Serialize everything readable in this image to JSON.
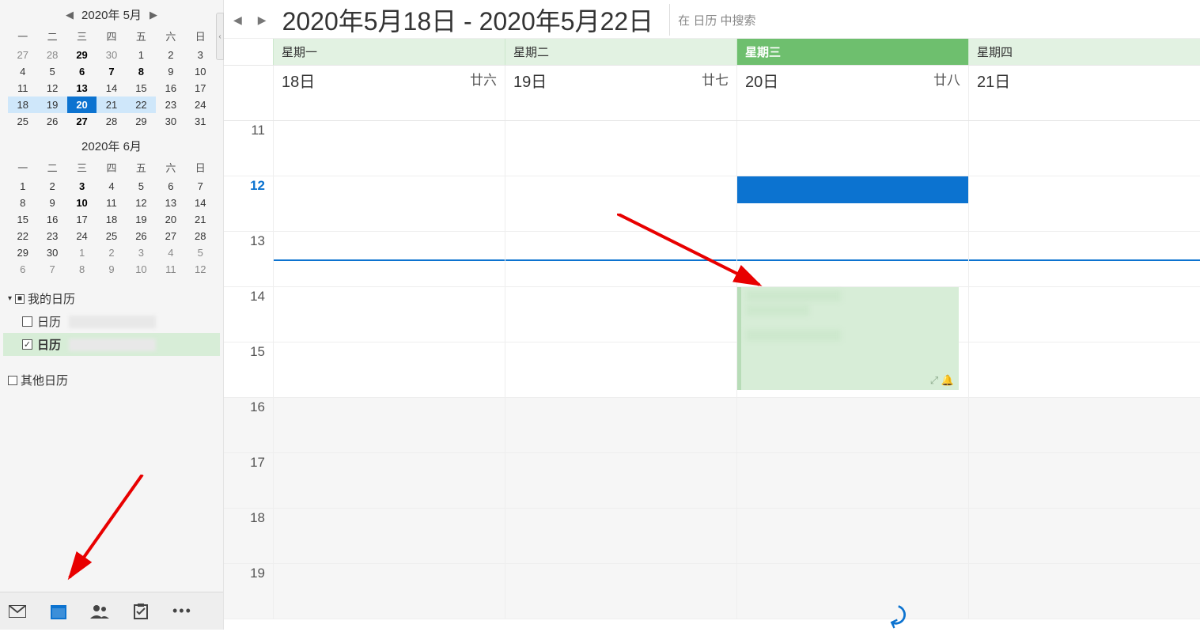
{
  "sidebar": {
    "miniCalendars": [
      {
        "title": "2020年 5月",
        "dow": [
          "一",
          "二",
          "三",
          "四",
          "五",
          "六",
          "日"
        ],
        "days": [
          {
            "n": "27"
          },
          {
            "n": "28"
          },
          {
            "n": "29",
            "bold": true
          },
          {
            "n": "30"
          },
          {
            "n": "1",
            "cur": true
          },
          {
            "n": "2",
            "cur": true
          },
          {
            "n": "3",
            "cur": true
          },
          {
            "n": "4",
            "cur": true
          },
          {
            "n": "5",
            "cur": true
          },
          {
            "n": "6",
            "bold": true,
            "cur": true
          },
          {
            "n": "7",
            "bold": true,
            "cur": true
          },
          {
            "n": "8",
            "bold": true,
            "cur": true
          },
          {
            "n": "9",
            "cur": true
          },
          {
            "n": "10",
            "cur": true
          },
          {
            "n": "11",
            "cur": true
          },
          {
            "n": "12",
            "cur": true
          },
          {
            "n": "13",
            "bold": true,
            "cur": true
          },
          {
            "n": "14",
            "cur": true
          },
          {
            "n": "15",
            "cur": true
          },
          {
            "n": "16",
            "cur": true
          },
          {
            "n": "17",
            "cur": true
          },
          {
            "n": "18",
            "cur": true,
            "selwk": true
          },
          {
            "n": "19",
            "cur": true,
            "selwk": true
          },
          {
            "n": "20",
            "cur": true,
            "today": true
          },
          {
            "n": "21",
            "cur": true,
            "selwk": true
          },
          {
            "n": "22",
            "cur": true,
            "selwk": true
          },
          {
            "n": "23",
            "cur": true
          },
          {
            "n": "24",
            "cur": true
          },
          {
            "n": "25",
            "cur": true
          },
          {
            "n": "26",
            "cur": true
          },
          {
            "n": "27",
            "bold": true,
            "cur": true
          },
          {
            "n": "28",
            "cur": true
          },
          {
            "n": "29",
            "cur": true
          },
          {
            "n": "30",
            "cur": true
          },
          {
            "n": "31",
            "cur": true
          }
        ]
      },
      {
        "title": "2020年 6月",
        "dow": [
          "一",
          "二",
          "三",
          "四",
          "五",
          "六",
          "日"
        ],
        "days": [
          {
            "n": "1",
            "cur": true
          },
          {
            "n": "2",
            "cur": true
          },
          {
            "n": "3",
            "bold": true,
            "cur": true
          },
          {
            "n": "4",
            "cur": true
          },
          {
            "n": "5",
            "cur": true
          },
          {
            "n": "6",
            "cur": true
          },
          {
            "n": "7",
            "cur": true
          },
          {
            "n": "8",
            "cur": true
          },
          {
            "n": "9",
            "cur": true
          },
          {
            "n": "10",
            "bold": true,
            "cur": true
          },
          {
            "n": "11",
            "cur": true
          },
          {
            "n": "12",
            "cur": true
          },
          {
            "n": "13",
            "cur": true
          },
          {
            "n": "14",
            "cur": true
          },
          {
            "n": "15",
            "cur": true
          },
          {
            "n": "16",
            "cur": true
          },
          {
            "n": "17",
            "cur": true
          },
          {
            "n": "18",
            "cur": true
          },
          {
            "n": "19",
            "cur": true
          },
          {
            "n": "20",
            "cur": true
          },
          {
            "n": "21",
            "cur": true
          },
          {
            "n": "22",
            "cur": true
          },
          {
            "n": "23",
            "cur": true
          },
          {
            "n": "24",
            "cur": true
          },
          {
            "n": "25",
            "cur": true
          },
          {
            "n": "26",
            "cur": true
          },
          {
            "n": "27",
            "cur": true
          },
          {
            "n": "28",
            "cur": true
          },
          {
            "n": "29",
            "cur": true
          },
          {
            "n": "30",
            "cur": true
          },
          {
            "n": "1"
          },
          {
            "n": "2"
          },
          {
            "n": "3"
          },
          {
            "n": "4"
          },
          {
            "n": "5"
          },
          {
            "n": "6"
          },
          {
            "n": "7"
          },
          {
            "n": "8"
          },
          {
            "n": "9"
          },
          {
            "n": "10"
          },
          {
            "n": "11"
          },
          {
            "n": "12"
          }
        ]
      }
    ],
    "myCalendars": {
      "header": "我的日历",
      "items": [
        {
          "label": "日历",
          "checked": false
        },
        {
          "label": "日历",
          "checked": true,
          "bold": true,
          "active": true
        }
      ]
    },
    "otherCalendars": {
      "header": "其他日历"
    }
  },
  "nav": {
    "icons": [
      "mail-icon",
      "calendar-icon",
      "people-icon",
      "tasks-icon",
      "more-icon"
    ]
  },
  "main": {
    "rangeTitle": "2020年5月18日 - 2020年5月22日",
    "searchPlaceholder": "在 日历 中搜索",
    "dayHeaders": [
      {
        "label": "星期一"
      },
      {
        "label": "星期二"
      },
      {
        "label": "星期三",
        "today": true
      },
      {
        "label": "星期四"
      }
    ],
    "dates": [
      {
        "d": "18日",
        "lunar": "廿六"
      },
      {
        "d": "19日",
        "lunar": "廿七"
      },
      {
        "d": "20日",
        "lunar": "廿八"
      },
      {
        "d": "21日",
        "lunar": ""
      }
    ],
    "hours": [
      "11",
      "12",
      "13",
      "14",
      "15",
      "16",
      "17",
      "18",
      "19"
    ],
    "currentHourIndex": 1
  }
}
